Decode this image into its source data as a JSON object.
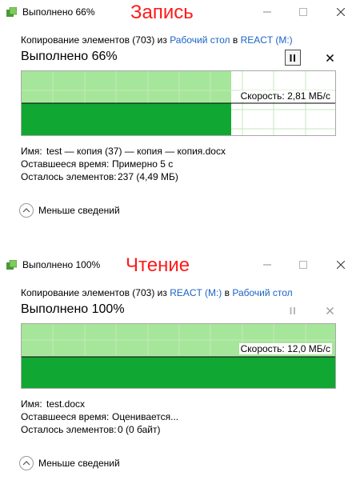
{
  "dialogs": [
    {
      "title": "Выполнено 66%",
      "overlay_label": "Запись",
      "copy_line": {
        "prefix": "Копирование элементов (703) из ",
        "source": "Рабочий стол",
        "middle": " в ",
        "destination": "REACT (M:)"
      },
      "progress_text": "Выполнено 66%",
      "percent": 66,
      "pause_active": true,
      "speed_label": "Скорость: 2,81 МБ/с",
      "name_label": "Имя:",
      "name_value": "test — копия (37) — копия — копия.docx",
      "time_label": "Оставшееся время:",
      "time_value": "Примерно 5 с",
      "items_label": "Осталось элементов:",
      "items_value": "237 (4,49 МБ)",
      "less_label": "Меньше сведений"
    },
    {
      "title": "Выполнено 100%",
      "overlay_label": "Чтение",
      "copy_line": {
        "prefix": "Копирование элементов (703) из ",
        "source": "REACT (M:)",
        "middle": " в ",
        "destination": "Рабочий стол"
      },
      "progress_text": "Выполнено 100%",
      "percent": 100,
      "pause_active": false,
      "speed_label": "Скорость: 12,0 МБ/с",
      "name_label": "Имя:",
      "name_value": "test.docx",
      "time_label": "Оставшееся время:",
      "time_value": "Оценивается...",
      "items_label": "Осталось элементов:",
      "items_value": "0 (0 байт)",
      "less_label": "Меньше сведений"
    }
  ],
  "colors": {
    "fill_done": "#10a832",
    "fill_bg": "#a6e69a",
    "grid": "#c5e8bd",
    "accent_link": "#1a63c6",
    "overlay": "#ff1a1a"
  },
  "icons": [
    "copy-app-icon",
    "minimize-icon",
    "maximize-icon",
    "close-icon",
    "pause-icon",
    "cancel-icon",
    "chevron-up-icon"
  ]
}
